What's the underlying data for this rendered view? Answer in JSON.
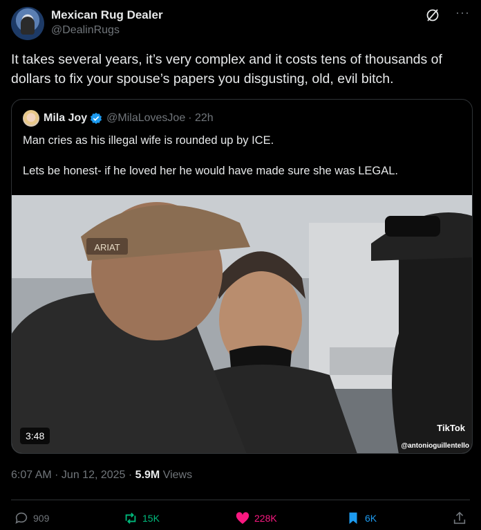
{
  "author": {
    "name": "Mexican Rug Dealer",
    "handle": "@DealinRugs"
  },
  "tweet": {
    "text": "It takes several years, it’s very complex and it costs tens of thousands of dollars to fix your spouse’s papers you disgusting, old, evil bitch."
  },
  "quote": {
    "name": "Mila Joy",
    "handle": "@MilaLovesJoe",
    "time": "· 22h",
    "text1": "Man cries as his illegal wife is rounded up by ICE.",
    "text2": "Lets be honest- if he loved her he would have made sure she was LEGAL.",
    "video": {
      "duration": "3:48",
      "watermark": "TikTok",
      "watermark_user": "@antonioguillentello",
      "cap_text": "ARIAT"
    }
  },
  "meta": {
    "time": "6:07 AM · Jun 12, 2025 · ",
    "views": "5.9M",
    "views_label": " Views"
  },
  "actions": {
    "replies": "909",
    "reposts": "15K",
    "likes": "228K",
    "bookmarks": "6K"
  },
  "colors": {
    "repost": "#00ba7c",
    "like": "#f91880",
    "bookmark": "#1d9bf0",
    "muted": "#71767b"
  }
}
